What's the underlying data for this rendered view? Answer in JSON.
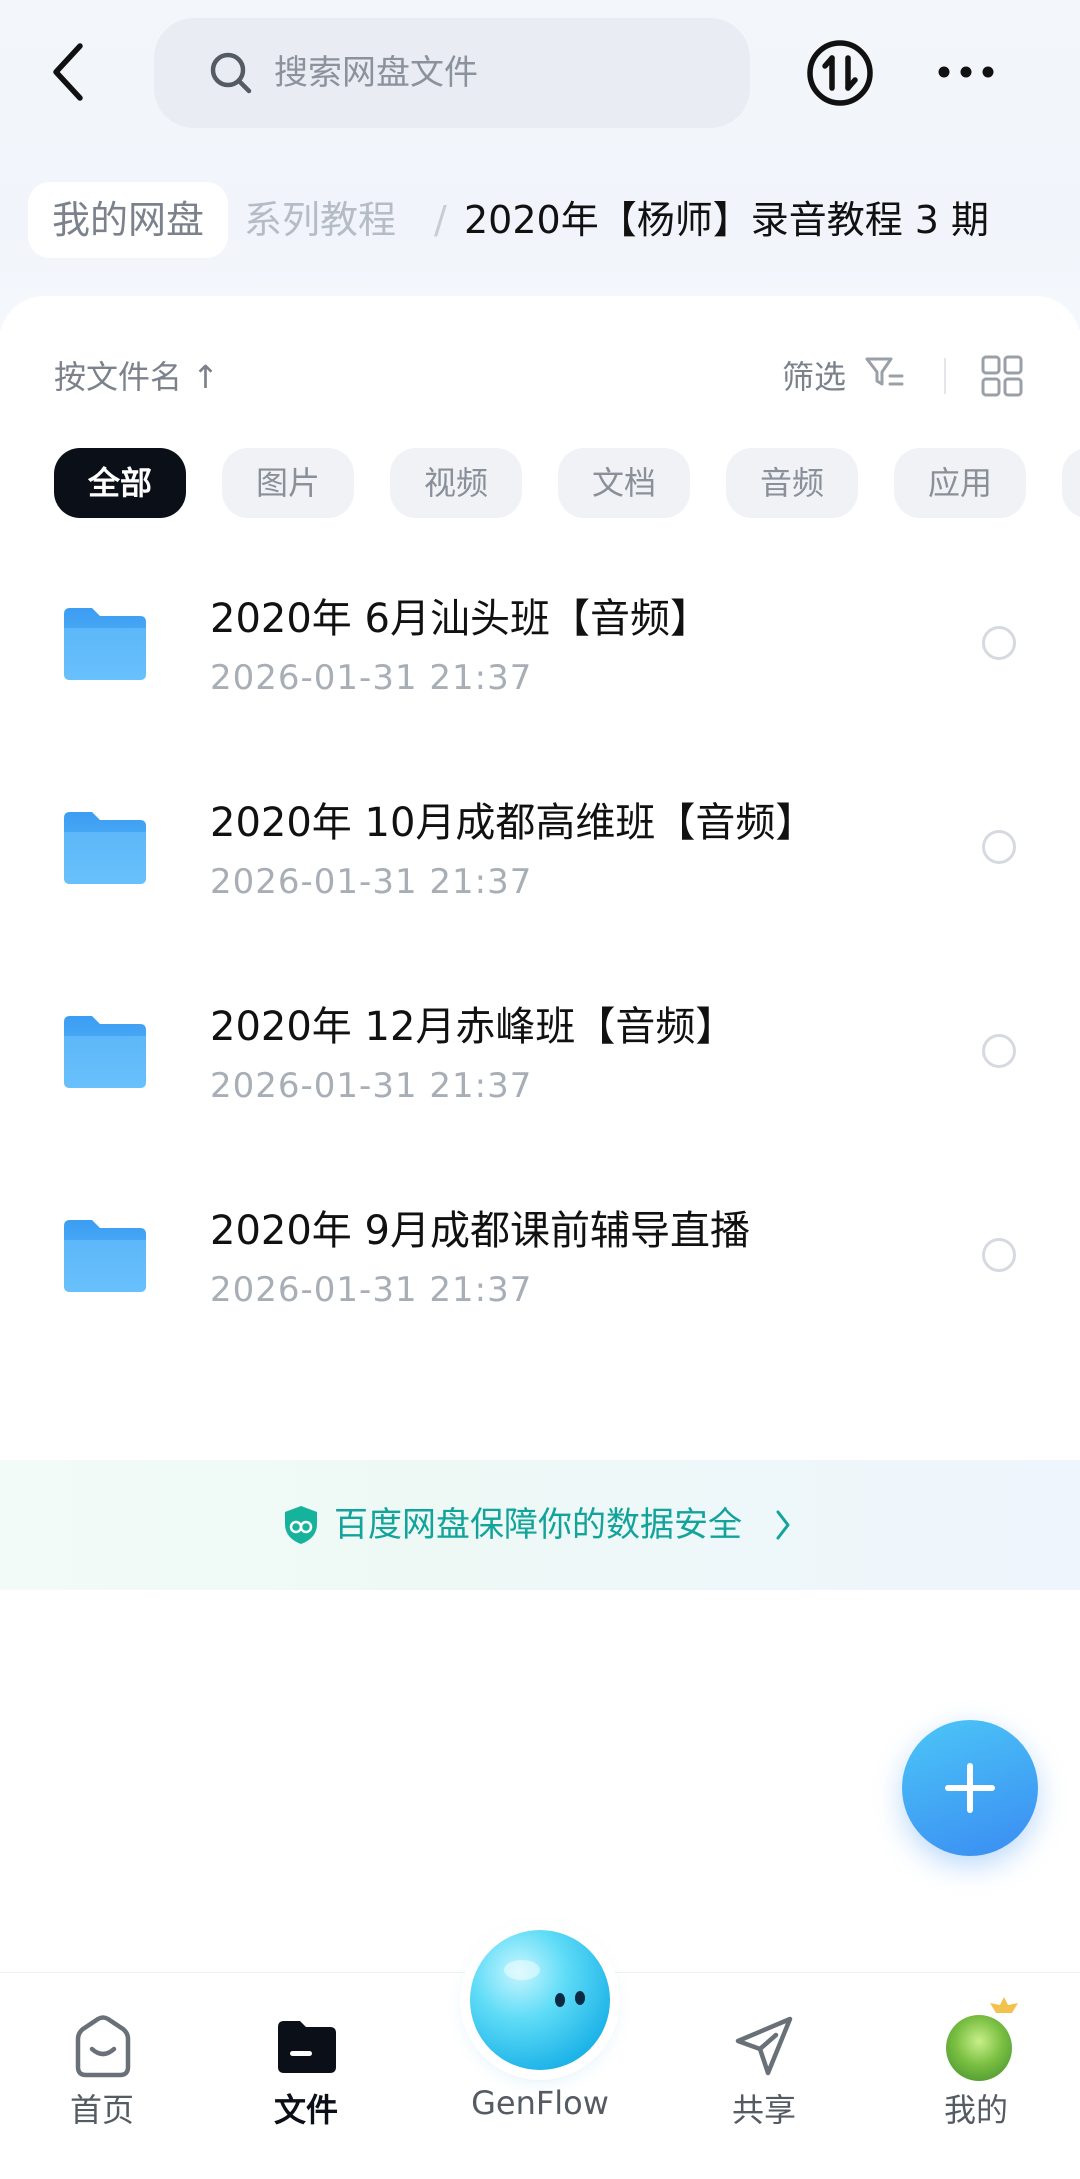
{
  "header": {
    "search_placeholder": "搜索网盘文件"
  },
  "breadcrumb": {
    "root": "我的网盘",
    "parent": "系列教程",
    "separator": "/",
    "current": "2020年【杨师】录音教程 3 期"
  },
  "toolbar": {
    "sort_label": "按文件名 ↑",
    "filter_label": "筛选"
  },
  "chips": [
    {
      "label": "全部",
      "active": true
    },
    {
      "label": "图片",
      "active": false
    },
    {
      "label": "视频",
      "active": false
    },
    {
      "label": "文档",
      "active": false
    },
    {
      "label": "音频",
      "active": false
    },
    {
      "label": "应用",
      "active": false
    }
  ],
  "files": [
    {
      "name": "2020年 6月汕头班【音频】",
      "date": "2026-01-31",
      "time": "21:37"
    },
    {
      "name": "2020年 10月成都高维班【音频】",
      "date": "2026-01-31",
      "time": "21:37"
    },
    {
      "name": "2020年 12月赤峰班【音频】",
      "date": "2026-01-31",
      "time": "21:37"
    },
    {
      "name": "2020年  9月成都课前辅导直播",
      "date": "2026-01-31",
      "time": "21:37"
    }
  ],
  "safety_banner": "百度网盘保障你的数据安全",
  "tabs": [
    {
      "label": "首页",
      "icon": "home-icon"
    },
    {
      "label": "文件",
      "icon": "folder-icon",
      "active": true
    },
    {
      "label": "GenFlow",
      "icon": "genflow-orb-icon"
    },
    {
      "label": "共享",
      "icon": "share-icon"
    },
    {
      "label": "我的",
      "icon": "avatar-icon"
    }
  ],
  "colors": {
    "accent_teal": "#12a39a",
    "fab_blue": "#3a8cf2",
    "folder_blue": "#4aa8f5"
  }
}
